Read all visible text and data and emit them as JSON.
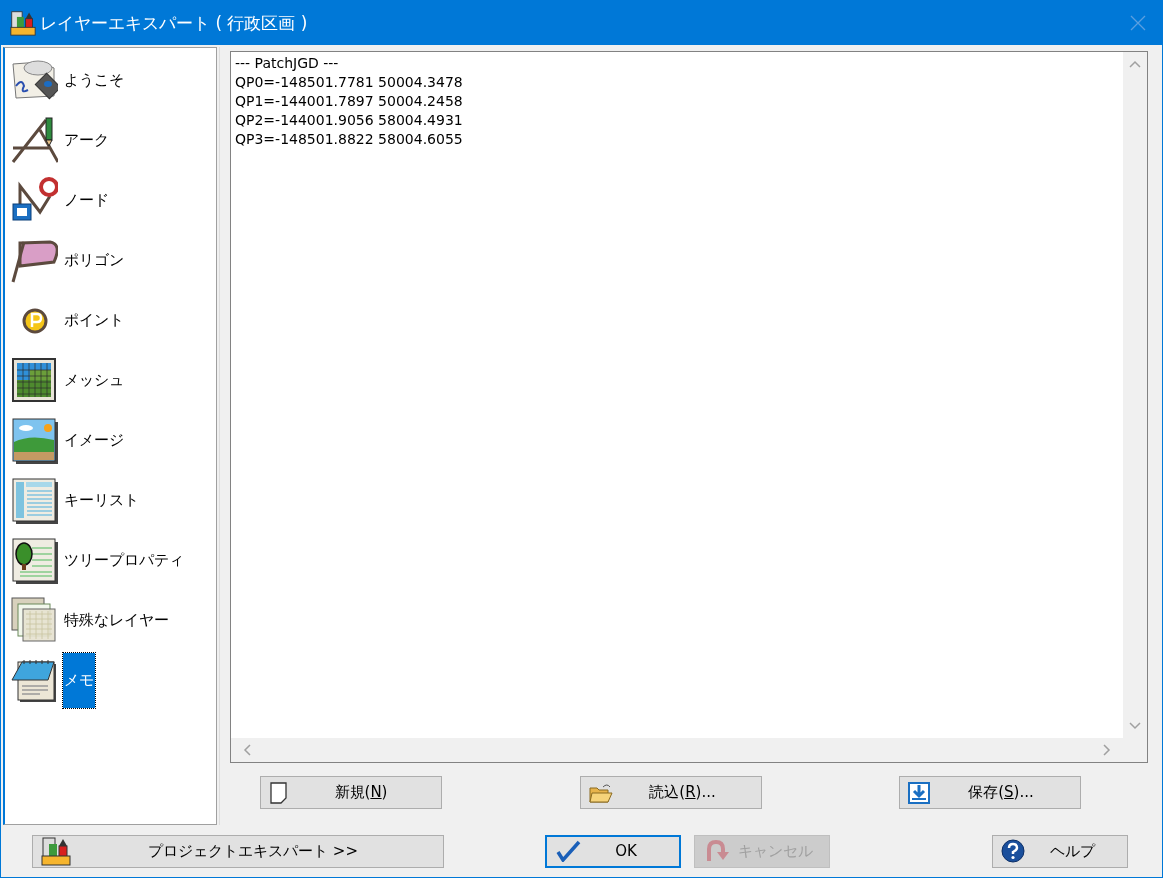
{
  "window": {
    "title": "レイヤーエキスパート ( 行政区画 )"
  },
  "sidebar": {
    "items": [
      {
        "label": "ようこそ",
        "selected": false
      },
      {
        "label": "アーク",
        "selected": false
      },
      {
        "label": "ノード",
        "selected": false
      },
      {
        "label": "ポリゴン",
        "selected": false
      },
      {
        "label": "ポイント",
        "selected": false
      },
      {
        "label": "メッシュ",
        "selected": false
      },
      {
        "label": "イメージ",
        "selected": false
      },
      {
        "label": "キーリスト",
        "selected": false
      },
      {
        "label": "ツリープロパティ",
        "selected": false
      },
      {
        "label": "特殊なレイヤー",
        "selected": false
      },
      {
        "label": "メモ",
        "selected": true
      }
    ]
  },
  "memo": {
    "lines": [
      "--- PatchJGD ---",
      "QP0=-148501.7781 50004.3478",
      "QP1=-144001.7897 50004.2458",
      "QP2=-144001.9056 58004.4931",
      "QP3=-148501.8822 58004.6055"
    ]
  },
  "memo_buttons": [
    {
      "kind": "new",
      "text": "新規(",
      "key": "N",
      "rest": ")"
    },
    {
      "kind": "open",
      "text": "読込(",
      "key": "R",
      "rest": ")..."
    },
    {
      "kind": "save",
      "text": "保存(",
      "key": "S",
      "rest": ")..."
    }
  ],
  "footer_buttons": [
    {
      "kind": "project",
      "label": "プロジェクトエキスパート >>",
      "default": false,
      "disabled": false
    },
    {
      "kind": "ok",
      "label": "OK",
      "default": true,
      "disabled": false
    },
    {
      "kind": "cancel",
      "label": "キャンセル",
      "default": false,
      "disabled": true
    },
    {
      "kind": "help",
      "label": "ヘルプ",
      "default": false,
      "disabled": false
    }
  ]
}
